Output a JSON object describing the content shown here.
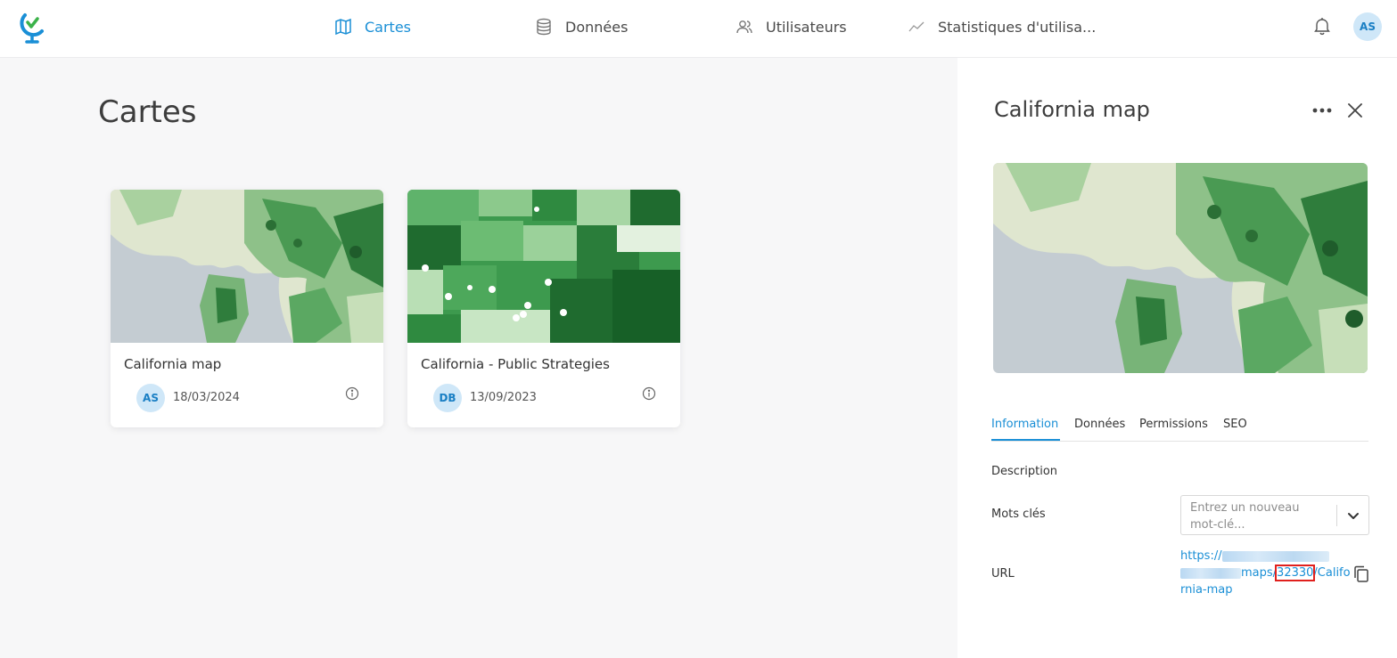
{
  "nav": {
    "items": [
      {
        "label": "Cartes",
        "icon": "map-icon",
        "active": true
      },
      {
        "label": "Données",
        "icon": "database-icon",
        "active": false
      },
      {
        "label": "Utilisateurs",
        "icon": "users-icon",
        "active": false
      },
      {
        "label": "Statistiques d'utilisa...",
        "icon": "chart-line-icon",
        "active": false
      }
    ],
    "user_initials": "AS"
  },
  "page": {
    "title": "Cartes"
  },
  "cards": [
    {
      "title": "California map",
      "initials": "AS",
      "date": "18/03/2024"
    },
    {
      "title": "California - Public Strategies",
      "initials": "DB",
      "date": "13/09/2023"
    }
  ],
  "panel": {
    "title": "California map",
    "tabs": [
      "Information",
      "Données",
      "Permissions",
      "SEO"
    ],
    "active_tab": "Information",
    "description_label": "Description",
    "keywords_label": "Mots clés",
    "keywords_placeholder": "Entrez un nouveau mot-clé...",
    "url_label": "URL",
    "url": {
      "prefix": "https://",
      "segment": "maps/",
      "id": "32330",
      "slug": "/California-map"
    }
  },
  "colors": {
    "accent": "#1a8fd6",
    "highlight": "#e0201d"
  }
}
